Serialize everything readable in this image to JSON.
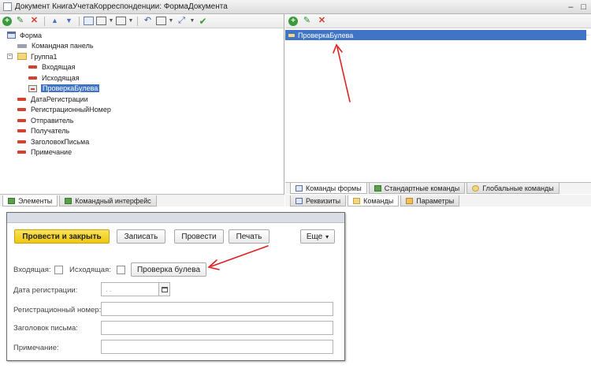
{
  "window": {
    "title": "Документ КнигаУчетаКорреспонденции: ФормаДокумента"
  },
  "tree": {
    "form": "Форма",
    "command_panel": "Командная панель",
    "group1": "Группа1",
    "incoming": "Входящая",
    "outgoing": "Исходящая",
    "check_bool": "ПроверкаБулева",
    "reg_date": "ДатаРегистрации",
    "reg_number": "РегистрационныйНомер",
    "sender": "Отправитель",
    "recipient": "Получатель",
    "letter_title": "ЗаголовокПисьма",
    "note": "Примечание"
  },
  "left_tabs": {
    "elements": "Элементы",
    "command_interface": "Командный интерфейс"
  },
  "commands": {
    "row1": "ПроверкаБулева"
  },
  "right_tabs": {
    "form_commands": "Команды формы",
    "standard_commands": "Стандартные команды",
    "global_commands": "Глобальные команды",
    "attributes": "Реквизиты",
    "commands": "Команды",
    "parameters": "Параметры"
  },
  "preview": {
    "post_close": "Провести и закрыть",
    "save": "Записать",
    "post": "Провести",
    "print": "Печать",
    "more": "Еще",
    "more_arrow": "▾",
    "incoming_label": "Входящая:",
    "outgoing_label": "Исходящая:",
    "check_button": "Проверка булева",
    "reg_date_label": "Дата регистрации:",
    "reg_date_value": ". .",
    "reg_number_label": "Регистрационный номер:",
    "letter_title_label": "Заголовок письма:",
    "note_label": "Примечание:"
  },
  "colors": {
    "selection": "#3f74c6",
    "primary_button": "#f2cd1e",
    "annotation_arrow": "#e02020"
  }
}
